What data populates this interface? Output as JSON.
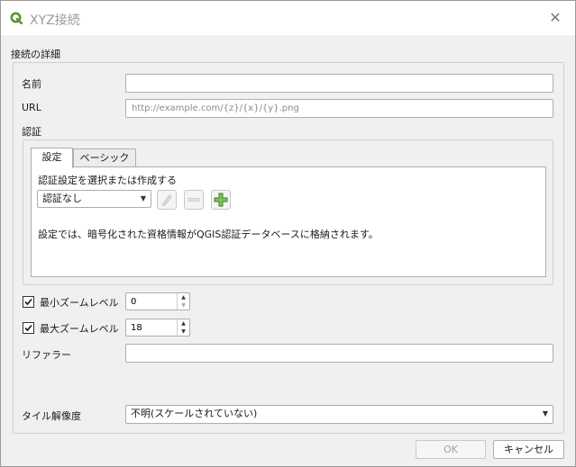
{
  "window": {
    "title": "XYZ接続",
    "close_glyph": "✕"
  },
  "section_heading": "接続の詳細",
  "name": {
    "label": "名前",
    "value": ""
  },
  "url": {
    "label": "URL",
    "value": "",
    "placeholder": "http://example.com/{z}/{x}/{y}.png"
  },
  "auth": {
    "label": "認証",
    "tabs": [
      {
        "label": "設定",
        "active": true
      },
      {
        "label": "ベーシック",
        "active": false
      }
    ],
    "select_label": "認証設定を選択または作成する",
    "selected": "認証なし",
    "buttons": {
      "edit_icon": "pencil-icon",
      "remove_icon": "minus-icon",
      "add_icon": "plus-icon"
    },
    "info": "設定では、暗号化された資格情報がQGIS認証データベースに格納されます。"
  },
  "min_zoom": {
    "label": "最小ズームレベル",
    "checked": true,
    "value": "0"
  },
  "max_zoom": {
    "label": "最大ズームレベル",
    "checked": true,
    "value": "18"
  },
  "referer": {
    "label": "リファラー",
    "value": ""
  },
  "tile_resolution": {
    "label": "タイル解像度",
    "selected": "不明(スケールされていない)"
  },
  "footer": {
    "ok_label": "OK",
    "cancel_label": "キャンセル"
  },
  "colors": {
    "qgis_green": "#589632",
    "checkbox_mark": "#1a1a1a"
  }
}
